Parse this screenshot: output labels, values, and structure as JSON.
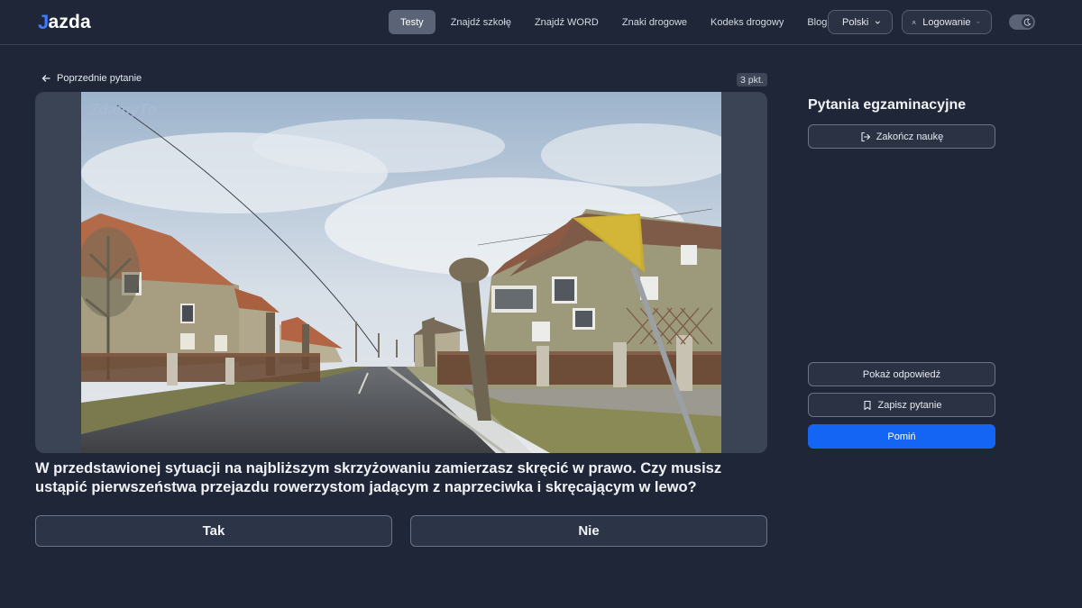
{
  "header": {
    "logo": {
      "initial": "J",
      "rest": "azda"
    },
    "nav": [
      {
        "label": "Testy",
        "active": true
      },
      {
        "label": "Znajdź szkołę",
        "active": false
      },
      {
        "label": "Znajdź WORD",
        "active": false
      },
      {
        "label": "Znaki drogowe",
        "active": false
      },
      {
        "label": "Kodeks drogowy",
        "active": false
      },
      {
        "label": "Blog",
        "active": false
      }
    ],
    "language": "Polski",
    "login": "Logowanie",
    "theme_toggle_icon": "moon-icon"
  },
  "question": {
    "prev_label": "Poprzednie pytanie",
    "points": "3 pkt.",
    "watermark": "ZdamyTo",
    "text": "W przedstawionej sytuacji na najbliższym skrzyżowaniu zamierzasz skręcić w prawo. Czy musisz ustąpić pierwszeństwa przejazdu rowerzystom jadącym z naprzeciwka i skręcającym w lewo?",
    "answers": [
      "Tak",
      "Nie"
    ]
  },
  "sidebar": {
    "title": "Pytania egzaminacyjne",
    "end_label": "Zakończ naukę",
    "show_answer_label": "Pokaż odpowiedź",
    "save_label": "Zapisz pytanie",
    "skip_label": "Pomiń"
  },
  "colors": {
    "background": "#1f2637",
    "accent": "#1565f5",
    "logo_accent": "#3d7bff"
  }
}
